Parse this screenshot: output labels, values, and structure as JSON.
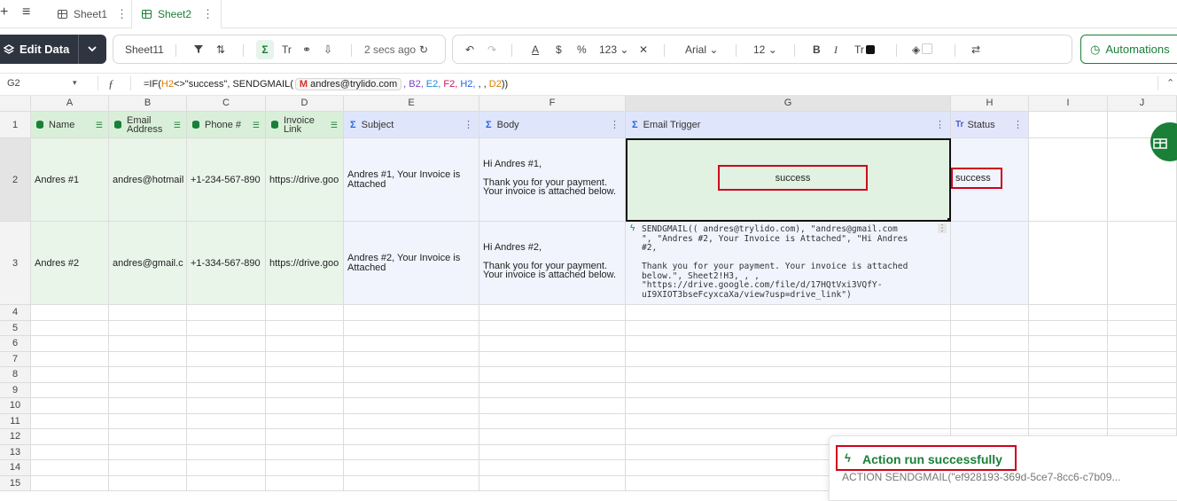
{
  "tabs": {
    "plus": "+",
    "menu": "≡",
    "items": [
      {
        "label": "Sheet1"
      },
      {
        "label": "Sheet2",
        "active": true
      }
    ]
  },
  "toolbar": {
    "edit_label": "Edit Data",
    "sheet_name": "Sheet11",
    "sort_label": "⇅",
    "sum_label": "Σ",
    "text_label": "Tr",
    "last_saved": "2 secs ago",
    "currency": "$",
    "percent": "%",
    "number_format": "123",
    "font": "Arial",
    "font_size": "12",
    "bold": "B",
    "italic": "I",
    "text_color": "Tr",
    "automations_label": "Automations"
  },
  "formula_bar": {
    "cell_ref": "G2",
    "fx": "ƒ",
    "formula_pre": "=IF(",
    "ref_h2": "H2",
    "formula_mid": "<>\"success\", SENDGMAIL(",
    "chip": "andres@trylido.com",
    "ref_b2": ", B2,",
    "ref_e2": " E2,",
    "ref_f2": " F2,",
    "ref_h2b": " H2,",
    "commas": " , , ",
    "ref_d2": "D2",
    "formula_end": "))"
  },
  "columns": [
    "A",
    "B",
    "C",
    "D",
    "E",
    "F",
    "G",
    "H",
    "I",
    "J"
  ],
  "headers": {
    "name": "Name",
    "email": "Email Address",
    "phone": "Phone #",
    "invoice": "Invoice Link",
    "subject": "Subject",
    "body": "Body",
    "trigger": "Email Trigger",
    "status": "Status"
  },
  "rows": [
    {
      "num": "2",
      "name": "Andres #1",
      "email": "andres@hotmail",
      "phone": "+1-234-567-890",
      "link": "https://drive.goo",
      "subject": "Andres #1, Your Invoice is Attached",
      "body_greeting": "Hi Andres #1,",
      "body_text": "Thank you for your payment. Your invoice is attached below.",
      "trigger": "success",
      "status": "success"
    },
    {
      "num": "3",
      "name": "Andres #2",
      "email": "andres@gmail.c",
      "phone": "+1-334-567-890",
      "link": "https://drive.goo",
      "subject": "Andres #2, Your Invoice is Attached",
      "body_greeting": "Hi Andres #2,",
      "body_text": "Thank you for your payment. Your invoice is attached below.",
      "trigger": "SENDGMAIL(( andres@trylido.com), \"andres@gmail.com\n\", \"Andres #2, Your Invoice is Attached\", \"Hi Andres\n#2,\n\nThank you for your payment. Your invoice is attached\nbelow.\", Sheet2!H3, , ,\n\"https://drive.google.com/file/d/17HQtVxi3VQfY-\nuI9XIOT3bseFcyxcaXa/view?usp=drive_link\")",
      "status": ""
    }
  ],
  "row_numbers": [
    "1",
    "2",
    "3",
    "4",
    "5",
    "6",
    "7",
    "8",
    "9",
    "10",
    "11",
    "12",
    "13",
    "14",
    "15"
  ],
  "toast": {
    "title": "Action run successfully",
    "subtitle": "ACTION SENDGMAIL(\"ef928193-369d-5ce7-8cc6-c7b09..."
  },
  "colors": {
    "accent_green": "#1a7f37",
    "highlight_red": "#d0021b",
    "formula_blue": "#2563eb"
  }
}
